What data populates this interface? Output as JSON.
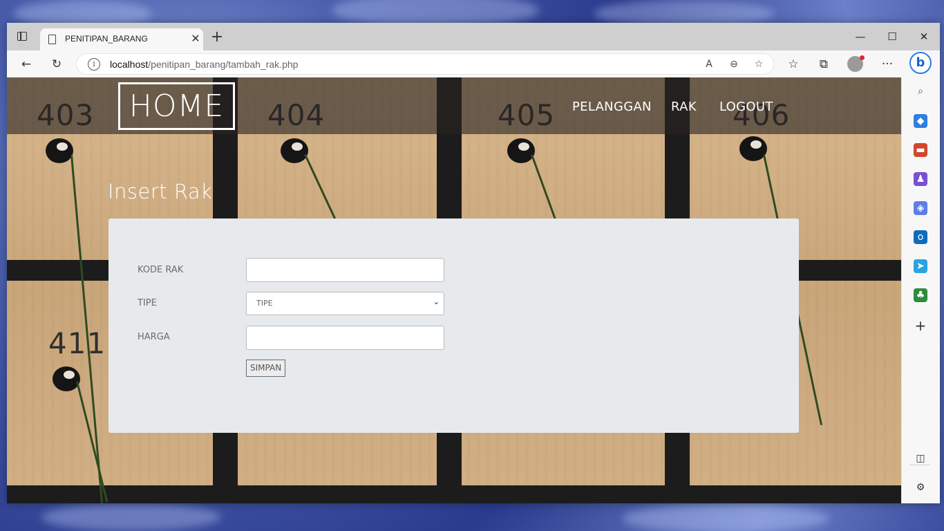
{
  "browser": {
    "tab_title": "PENITIPAN_BARANG",
    "tab_close": "✕",
    "new_tab": "+",
    "url_host": "localhost",
    "url_path": "/penitipan_barang/tambah_rak.php",
    "window_controls": {
      "minimize": "—",
      "maximize": "☐",
      "close": "✕"
    },
    "more_menu": "···"
  },
  "page": {
    "logo": "HOME",
    "nav": [
      {
        "label": "PELANGGAN"
      },
      {
        "label": "RAK"
      },
      {
        "label": "LOGOUT"
      }
    ],
    "section_title": "Insert Rak",
    "form": {
      "kode_rak_label": "KODE RAK",
      "kode_rak_value": "",
      "tipe_label": "TIPE",
      "tipe_selected": "TIPE",
      "harga_label": "HARGA",
      "harga_value": "",
      "submit_label": "SIMPAN"
    },
    "background_numbers": [
      "403",
      "404",
      "405",
      "406",
      "411"
    ]
  },
  "colors": {
    "form_panel": "#e7eaed",
    "nav_overlay": "rgba(40,36,34,0.62)",
    "bing_accent": "#2a7be4"
  }
}
